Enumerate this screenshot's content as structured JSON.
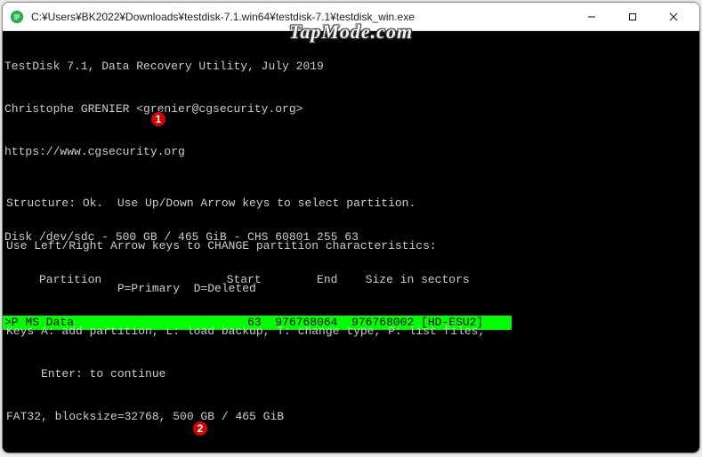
{
  "window": {
    "title": "C:¥Users¥BK2022¥Downloads¥testdisk-7.1.win64¥testdisk-7.1¥testdisk_win.exe"
  },
  "watermark": "TapMode.com",
  "term": {
    "l1": "TestDisk 7.1, Data Recovery Utility, July 2019",
    "l2": "Christophe GRENIER <grenier@cgsecurity.org>",
    "l3": "https://www.cgsecurity.org",
    "disk": "Disk /dev/sdc - 500 GB / 465 GiB - CHS 60801 255 63",
    "header": "     Partition                  Start        End    Size in sectors",
    "sel": ">P MS Data                         63  976768064  976768002 [HD-ESU2]",
    "b1": "Structure: Ok.  Use Up/Down Arrow keys to select partition.",
    "b2": "Use Left/Right Arrow keys to CHANGE partition characteristics:",
    "b3": "                P=Primary  D=Deleted",
    "b4": "Keys A: add partition, L: load backup, T: change type, P: list files,",
    "b5": "     Enter: to continue",
    "b6": "FAT32, blocksize=32768, 500 GB / 465 GiB"
  },
  "badges": {
    "one": "1",
    "two": "2"
  }
}
